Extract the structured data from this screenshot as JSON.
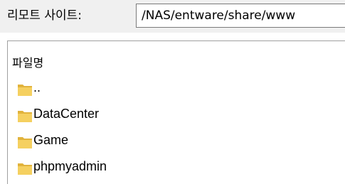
{
  "remote_site": {
    "label": "리모트 사이트:",
    "path_value": "/NAS/entware/share/www"
  },
  "file_list": {
    "column_filename": "파일명",
    "items": [
      {
        "name": "..",
        "icon": "folder-icon"
      },
      {
        "name": "DataCenter",
        "icon": "folder-icon"
      },
      {
        "name": "Game",
        "icon": "folder-icon"
      },
      {
        "name": "phpmyadmin",
        "icon": "folder-icon"
      }
    ]
  },
  "colors": {
    "folder": "#f5d060",
    "folder_dark": "#e1b33c",
    "toolbar_bg": "#f0f0f0"
  }
}
